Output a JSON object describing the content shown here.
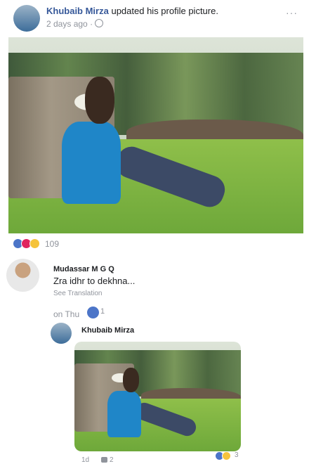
{
  "post": {
    "author": "Khubaib Mirza",
    "action": "updated his profile picture.",
    "time": "2 days ago",
    "dot": "·",
    "menu": "···",
    "reaction_count": "109"
  },
  "comment": {
    "author": "Mudassar M G Q",
    "text": "Zra idhr to dekhna...",
    "see_translation": "See Translation",
    "time": "on Thu",
    "like_count": "1"
  },
  "reply": {
    "author": "Khubaib Mirza",
    "time": "1d",
    "like_count": "2",
    "reaction_count": "3"
  },
  "colors": {
    "like_blue": "#4c75c8",
    "love_red": "#e0245e",
    "wow_yellow": "#f5c33b"
  }
}
